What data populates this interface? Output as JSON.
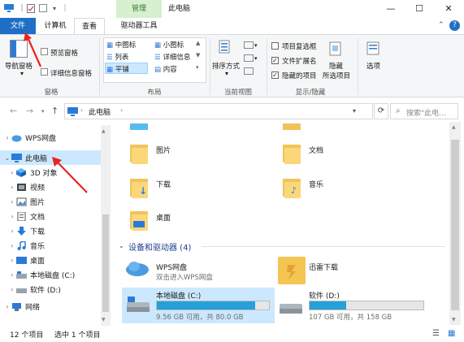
{
  "window": {
    "title": "此电脑",
    "context_tab": "管理",
    "controls": {
      "minimize": "—",
      "maximize": "☐",
      "close": "✕"
    }
  },
  "ribbon_tabs": {
    "file": "文件",
    "computer": "计算机",
    "view": "查看",
    "drive_tools": "驱动器工具"
  },
  "ribbon": {
    "panes": {
      "label": "窗格",
      "nav_pane": "导航窗格",
      "preview_pane": "预览窗格",
      "details_pane": "详细信息窗格"
    },
    "layout": {
      "label": "布局",
      "items": [
        "中图标",
        "小图标",
        "列表",
        "详细信息",
        "平铺",
        "内容"
      ]
    },
    "current_view": {
      "label": "当前视图",
      "sort": "排序方式"
    },
    "show_hide": {
      "label": "显示/隐藏",
      "item_checkboxes": "项目复选框",
      "file_extensions": "文件扩展名",
      "hidden_items": "隐藏的项目",
      "hide_selected": "隐藏",
      "hide_selected_2": "所选项目"
    },
    "options": "选项"
  },
  "address": {
    "breadcrumb": "此电脑",
    "search_placeholder": "搜索\"此电…"
  },
  "nav": {
    "items": [
      "WPS网盘",
      "此电脑",
      "3D 对象",
      "视频",
      "图片",
      "文档",
      "下载",
      "音乐",
      "桌面",
      "本地磁盘 (C:)",
      "软件 (D:)",
      "网络"
    ]
  },
  "folders": [
    "图片",
    "文档",
    "下载",
    "音乐",
    "桌面"
  ],
  "devices": {
    "header": "设备和驱动器 (4)",
    "wps": {
      "name": "WPS网盘",
      "sub": "双击进入WPS网盘"
    },
    "xunlei": {
      "name": "迅雷下载"
    },
    "c_drive": {
      "name": "本地磁盘 (C:)",
      "info": "9.56 GB 可用，共 80.0 GB",
      "used_fraction": 0.88
    },
    "d_drive": {
      "name": "软件 (D:)",
      "info": "107 GB 可用，共 158 GB",
      "used_fraction": 0.32
    }
  },
  "status": {
    "count": "12 个项目",
    "selected": "选中 1 个项目"
  },
  "colors": {
    "accent": "#1f6fc6",
    "drive_bar": "#26a0da",
    "folder": "#f0c35a",
    "selection": "#cce8ff",
    "annotation": "#e8241e"
  }
}
